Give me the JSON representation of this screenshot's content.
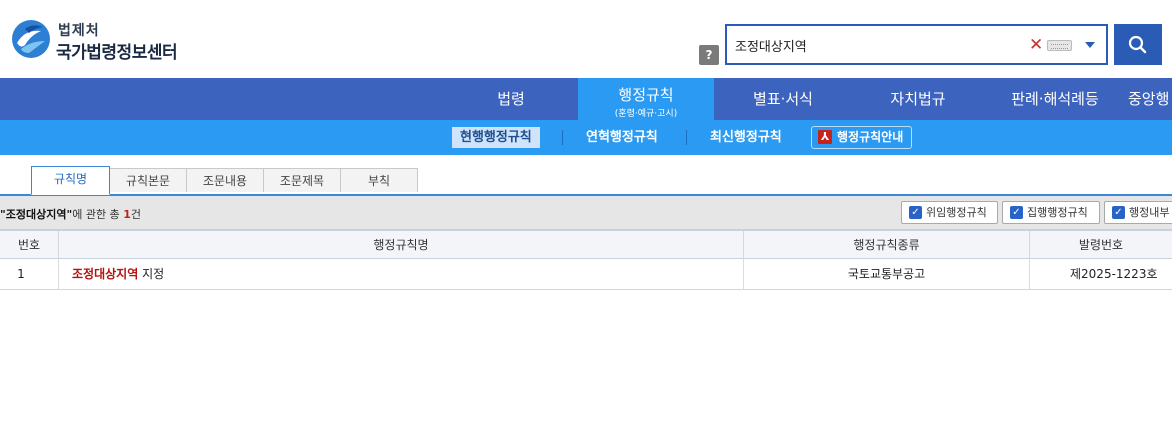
{
  "header": {
    "org_name": "법제처",
    "site_title": "국가법령정보센터",
    "help_label": "?",
    "search": {
      "value": "조정대상지역",
      "clear_label": "✕"
    }
  },
  "main_nav": {
    "items": [
      {
        "label": "법령"
      },
      {
        "label": "행정규칙",
        "sub": "(훈령·예규·고시)"
      },
      {
        "label": "별표·서식"
      },
      {
        "label": "자치법규"
      },
      {
        "label": "판례·해석례등"
      },
      {
        "label": "중앙행"
      }
    ]
  },
  "sub_nav": {
    "items": [
      {
        "label": "현행행정규칙"
      },
      {
        "label": "연혁행정규칙"
      },
      {
        "label": "최신행정규칙"
      }
    ],
    "guide_label": "행정규칙안내"
  },
  "tabs": [
    {
      "label": "규칙명"
    },
    {
      "label": "규칙본문"
    },
    {
      "label": "조문내용"
    },
    {
      "label": "조문제목"
    },
    {
      "label": "부칙"
    }
  ],
  "result": {
    "quote_open": "\"",
    "keyword": "조정대상지역",
    "quote_close": "\"",
    "middle": "에 관한  총 ",
    "count": "1",
    "unit": "건",
    "filters": [
      {
        "label": "위임행정규칙",
        "checked": true
      },
      {
        "label": "집행행정규칙",
        "checked": true
      },
      {
        "label": "행정내부",
        "checked": true
      }
    ]
  },
  "table": {
    "headers": [
      "번호",
      "행정규칙명",
      "행정규칙종류",
      "발령번호"
    ],
    "rows": [
      {
        "no": "1",
        "name_highlight": "조정대상지역",
        "name_rest": " 지정",
        "type": "국토교통부공고",
        "order_no": "제2025-1223호"
      }
    ]
  },
  "colors": {
    "nav_bg": "#3c63be",
    "nav_active_bg": "#2b9af3",
    "subnav_bg": "#2b9af3",
    "search_border": "#2a5cb6",
    "highlight": "#b4120f"
  }
}
